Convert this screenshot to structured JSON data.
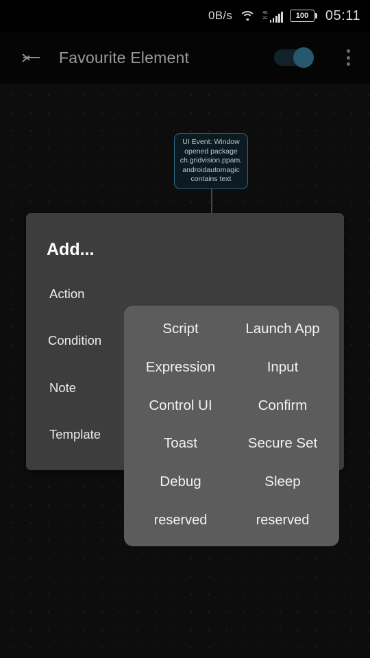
{
  "status_bar": {
    "network_speed": "0B/s",
    "wifi_icon": "wifi-icon",
    "signal_labels": [
      "4G",
      "2G"
    ],
    "battery_level": "100",
    "clock": "05:11"
  },
  "app_bar": {
    "back_icon": "back-arrow-icon",
    "title": "Favourite Element",
    "toggle": {
      "name": "enable-toggle",
      "state": "on",
      "accent_color": "#27596e"
    },
    "overflow_icon": "overflow-menu-icon"
  },
  "canvas": {
    "trigger_node": {
      "text": "UI Event: Window opened package ch.gridvision.ppam.androidautomagic contains text",
      "border_color": "#2a6a7e",
      "fill_color": "#0c1a21"
    },
    "fab": {
      "icon": "plus-icon",
      "label": "+"
    }
  },
  "add_menu": {
    "title": "Add...",
    "categories": [
      {
        "label": "Action"
      },
      {
        "label": "Condition"
      },
      {
        "label": "Note"
      },
      {
        "label": "Template"
      }
    ],
    "submenu_items": [
      {
        "label": "Script"
      },
      {
        "label": "Launch App"
      },
      {
        "label": "Expression"
      },
      {
        "label": "Input"
      },
      {
        "label": "Control UI"
      },
      {
        "label": "Confirm"
      },
      {
        "label": "Toast"
      },
      {
        "label": "Secure Set"
      },
      {
        "label": "Debug"
      },
      {
        "label": "Sleep"
      },
      {
        "label": "reserved"
      },
      {
        "label": "reserved"
      }
    ]
  }
}
